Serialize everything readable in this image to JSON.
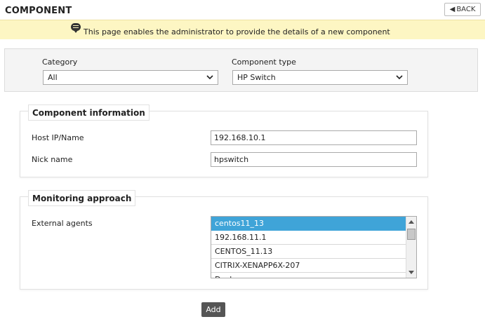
{
  "header": {
    "title": "COMPONENT",
    "back_label": "BACK"
  },
  "info": {
    "message": "This page enables the administrator to provide the details of a new component"
  },
  "filters": {
    "category_label": "Category",
    "category_value": "All",
    "component_type_label": "Component type",
    "component_type_value": "HP Switch"
  },
  "component_info": {
    "legend": "Component information",
    "host_label": "Host IP/Name",
    "host_value": "192.168.10.1",
    "nick_label": "Nick name",
    "nick_value": "hpswitch"
  },
  "monitoring": {
    "legend": "Monitoring approach",
    "agents_label": "External agents",
    "agents": [
      "centos11_13",
      "192.168.11.1",
      "CENTOS_11.13",
      "CITRIX-XENAPP6X-207",
      "Docker_..."
    ],
    "selected_index": 0
  },
  "actions": {
    "add_label": "Add"
  }
}
